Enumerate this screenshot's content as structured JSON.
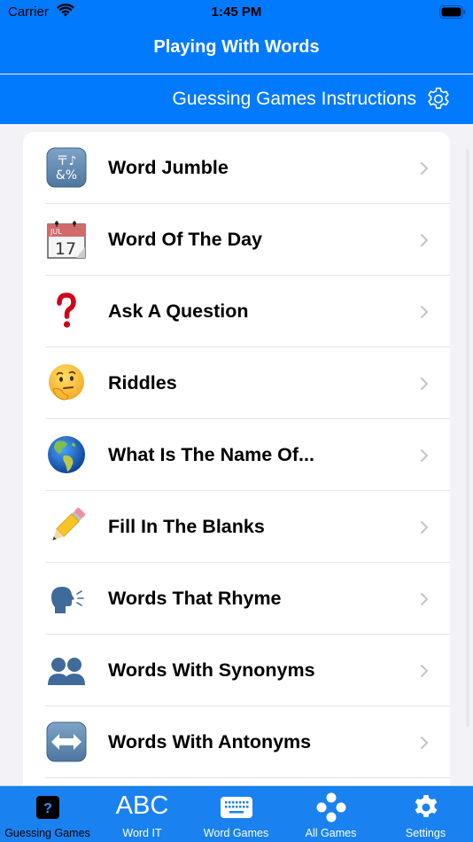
{
  "status_bar": {
    "carrier": "Carrier",
    "time": "1:45 PM"
  },
  "nav": {
    "title": "Playing With Words"
  },
  "sub_bar": {
    "instructions_label": "Guessing Games Instructions"
  },
  "list": {
    "items": [
      {
        "label": "Word Jumble",
        "icon": "input-symbols-icon"
      },
      {
        "label": "Word Of The Day",
        "icon": "calendar-icon"
      },
      {
        "label": "Ask A Question",
        "icon": "question-mark-icon"
      },
      {
        "label": "Riddles",
        "icon": "thinking-face-icon"
      },
      {
        "label": "What Is The Name Of...",
        "icon": "globe-americas-icon"
      },
      {
        "label": "Fill In The Blanks",
        "icon": "pencil-icon"
      },
      {
        "label": "Words That Rhyme",
        "icon": "speaking-head-icon"
      },
      {
        "label": "Words With Synonyms",
        "icon": "busts-icon"
      },
      {
        "label": "Words With Antonyms",
        "icon": "left-right-arrow-icon"
      }
    ],
    "calendar": {
      "month": "JUL",
      "day": "17"
    }
  },
  "tab_bar": {
    "active": "Guessing Games",
    "items": [
      {
        "label": "Guessing Games",
        "icon": "question-square-icon"
      },
      {
        "label": "Word IT",
        "icon": "abc-icon",
        "icon_text": "ABC"
      },
      {
        "label": "Word Games",
        "icon": "keyboard-icon"
      },
      {
        "label": "All Games",
        "icon": "game-controller-dots-icon"
      },
      {
        "label": "Settings",
        "icon": "gear-icon"
      }
    ]
  },
  "colors": {
    "primary": "#027afe",
    "tab_bar": "#1a82f0",
    "background": "#f2f2f7",
    "separator": "#e5e5ea",
    "chevron": "#c4c4c7"
  }
}
